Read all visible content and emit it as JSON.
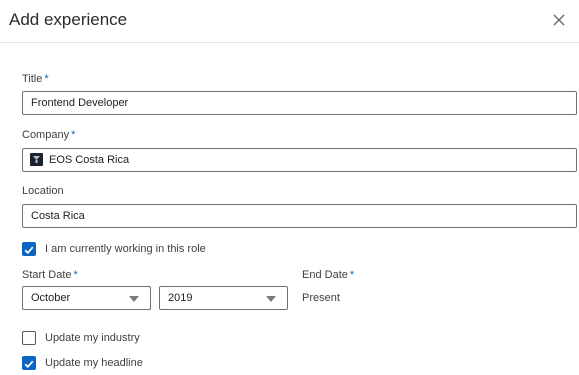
{
  "dialog": {
    "title": "Add experience",
    "close_icon": "close-icon"
  },
  "form": {
    "title_label": "Title",
    "title_value": "Frontend Developer",
    "company_label": "Company",
    "company_value": "EOS Costa Rica",
    "company_logo_icon": "company-logo-icon",
    "location_label": "Location",
    "location_value": "Costa Rica",
    "required_marker": "*",
    "currently_working": {
      "label": "I am currently working in this role",
      "checked": true
    },
    "start_date": {
      "label": "Start Date",
      "month": "October",
      "year": "2019"
    },
    "end_date": {
      "label": "End Date",
      "value": "Present"
    },
    "update_industry": {
      "label": "Update my industry",
      "checked": false
    },
    "update_headline": {
      "label": "Update my headline",
      "checked": true
    }
  },
  "colors": {
    "accent": "#0a66c2",
    "border": "#6f6f6f",
    "text": "#2b2b2b"
  }
}
